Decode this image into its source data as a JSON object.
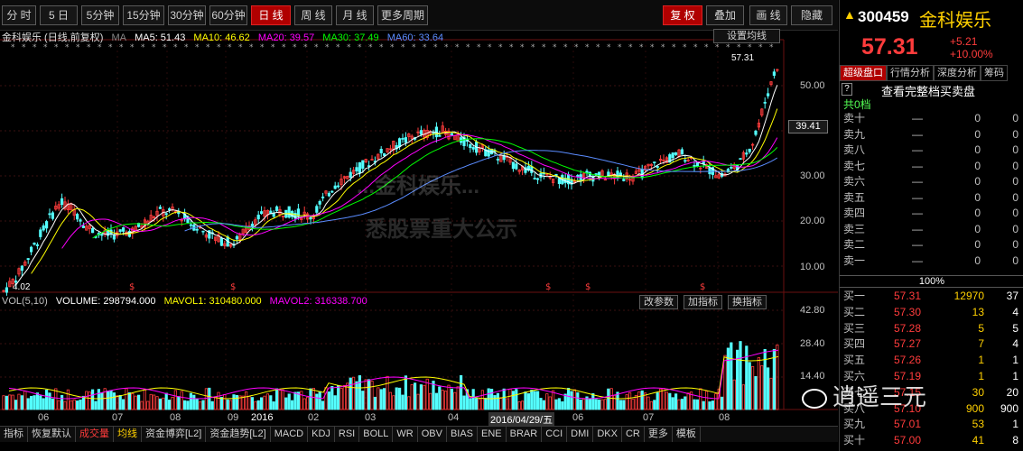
{
  "toolbar": {
    "left_buttons": [
      "分 时",
      "5 日",
      "5分钟",
      "15分钟",
      "30分钟",
      "60分钟",
      "日 线",
      "周 线",
      "月 线",
      "更多周期"
    ],
    "active": "日 线",
    "right_buttons": [
      "复 权",
      "叠加",
      "画 线",
      "隐藏"
    ],
    "right_active": "复 权"
  },
  "price_panel": {
    "title": "金科娱乐 (日线,前复权)",
    "ma_label": "MA",
    "ma5": "MA5: 51.43",
    "ma10": "MA10: 46.62",
    "ma20": "MA20: 39.57",
    "ma30": "MA30: 37.49",
    "ma60": "MA60: 33.64",
    "settings_button": "设置均线",
    "high_label": "57.31",
    "low_label": "4.02",
    "cursor_price": "39.41",
    "y_ticks": [
      "50.00",
      "40.00",
      "30.00",
      "20.00",
      "10.00"
    ]
  },
  "volume_panel": {
    "title": "VOL(5,10)",
    "volume": "VOLUME: 298794.000",
    "mavol1": "MAVOL1: 310480.000",
    "mavol2": "MAVOL2: 316338.700",
    "buttons": [
      "改参数",
      "加指标",
      "换指标"
    ],
    "y_ticks": [
      "42.80",
      "28.40",
      "14.40"
    ]
  },
  "x_axis": {
    "labels": [
      "06",
      "07",
      "08",
      "09",
      "2016",
      "02",
      "03",
      "04",
      "2016/04/29/五",
      "06",
      "07",
      "08"
    ]
  },
  "watermark": {
    "line1": "...金科娱乐...",
    "line2": "悉股票重大公示",
    "brand": "逍遥三元"
  },
  "bottom_tabs": [
    "指标",
    "恢复默认",
    "成交量",
    "均线",
    "资金博弈[L2]",
    "资金趋势[L2]",
    "MACD",
    "KDJ",
    "RSI",
    "BOLL",
    "WR",
    "OBV",
    "BIAS",
    "ENE",
    "BRAR",
    "CCI",
    "DMI",
    "DKX",
    "CR",
    "更多",
    "模板"
  ],
  "quote": {
    "code": "300459",
    "name": "金科娱乐",
    "price": "57.31",
    "change": "+5.21",
    "change_pct": "+10.00%"
  },
  "rp_tabs": [
    "超级盘口",
    "行情分析",
    "深度分析",
    "筹码"
  ],
  "orderbook": {
    "help": "?",
    "header": "查看完整档买卖盘",
    "total_label": "共0档",
    "sells": [
      {
        "label": "卖十",
        "price": "—",
        "vol": "0",
        "count": "0"
      },
      {
        "label": "卖九",
        "price": "—",
        "vol": "0",
        "count": "0"
      },
      {
        "label": "卖八",
        "price": "—",
        "vol": "0",
        "count": "0"
      },
      {
        "label": "卖七",
        "price": "—",
        "vol": "0",
        "count": "0"
      },
      {
        "label": "卖六",
        "price": "—",
        "vol": "0",
        "count": "0"
      },
      {
        "label": "卖五",
        "price": "—",
        "vol": "0",
        "count": "0"
      },
      {
        "label": "卖四",
        "price": "—",
        "vol": "0",
        "count": "0"
      },
      {
        "label": "卖三",
        "price": "—",
        "vol": "0",
        "count": "0"
      },
      {
        "label": "卖二",
        "price": "—",
        "vol": "0",
        "count": "0"
      },
      {
        "label": "卖一",
        "price": "—",
        "vol": "0",
        "count": "0"
      }
    ],
    "ratio": "100%",
    "buys": [
      {
        "label": "买一",
        "price": "57.31",
        "vol": "12970",
        "count": "37"
      },
      {
        "label": "买二",
        "price": "57.30",
        "vol": "13",
        "count": "4"
      },
      {
        "label": "买三",
        "price": "57.28",
        "vol": "5",
        "count": "5"
      },
      {
        "label": "买四",
        "price": "57.27",
        "vol": "7",
        "count": "4"
      },
      {
        "label": "买五",
        "price": "57.26",
        "vol": "1",
        "count": "1"
      },
      {
        "label": "买六",
        "price": "57.19",
        "vol": "1",
        "count": "1"
      },
      {
        "label": "买七",
        "price": "57.15",
        "vol": "30",
        "count": "20"
      },
      {
        "label": "买八",
        "price": "57.10",
        "vol": "900",
        "count": "900"
      },
      {
        "label": "买九",
        "price": "57.01",
        "vol": "53",
        "count": "1"
      },
      {
        "label": "买十",
        "price": "57.00",
        "vol": "41",
        "count": "8"
      }
    ]
  },
  "colors": {
    "up": "#ff3c3c",
    "down": "#54ffff",
    "ma5": "#ffffff",
    "ma10": "#ffff00",
    "ma20": "#ff00ff",
    "ma30": "#00ff00",
    "ma60": "#5a8cff"
  }
}
